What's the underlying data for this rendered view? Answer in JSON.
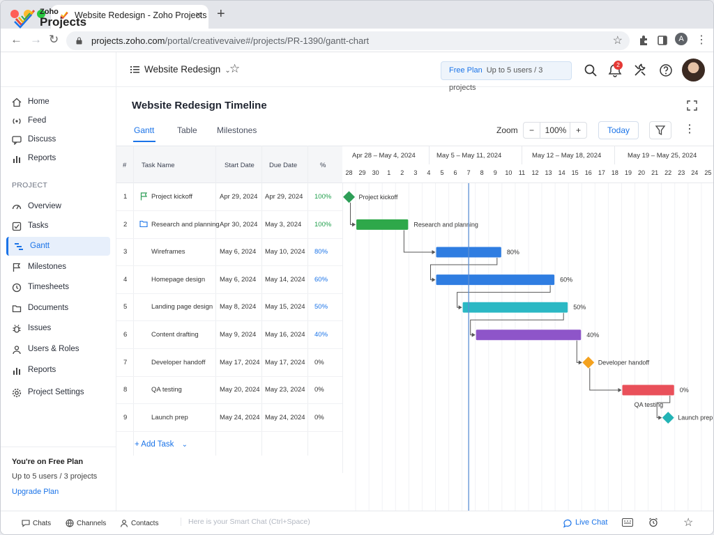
{
  "browser": {
    "tab_title": "Website Redesign - Zoho Projects",
    "url_host": "projects.zoho.com",
    "url_path": "/portal/creativevaive#/projects/PR-1390/gantt-chart",
    "account_initial": "A"
  },
  "brand": {
    "line1": "Zoho",
    "line2": "Projects"
  },
  "header": {
    "project_name": "Website Redesign",
    "plan_label": "Free Plan",
    "plan_text": "Up to 5 users / 3 projects",
    "notification_count": "2"
  },
  "sidebar": {
    "top_items": [
      {
        "label": "Home",
        "icon": "home-icon"
      },
      {
        "label": "Feed",
        "icon": "feed-icon"
      },
      {
        "label": "Discuss",
        "icon": "discuss-icon"
      },
      {
        "label": "Reports",
        "icon": "reports-icon"
      }
    ],
    "section_label": "PROJECT",
    "project_items": [
      {
        "label": "Overview"
      },
      {
        "label": "Tasks"
      },
      {
        "label": "Gantt",
        "active": true
      },
      {
        "label": "Milestones"
      },
      {
        "label": "Timesheets"
      },
      {
        "label": "Documents"
      },
      {
        "label": "Issues"
      },
      {
        "label": "Users & Roles"
      },
      {
        "label": "Reports"
      },
      {
        "label": "Project Settings"
      }
    ],
    "plan_title": "You're on Free Plan",
    "plan_desc": "Up to 5 users / 3 projects",
    "upgrade_label": "Upgrade Plan"
  },
  "main": {
    "title": "Website Redesign Timeline",
    "tabs": [
      "Gantt",
      "Table",
      "Milestones"
    ],
    "active_tab": "Gantt",
    "zoom_label": "Zoom",
    "zoom_value": "100%",
    "zoom_minus": "−",
    "zoom_plus": "+",
    "today_label": "Today",
    "add_task_label": "+ Add Task"
  },
  "grid": {
    "columns": [
      "#",
      "Task Name",
      "Start Date",
      "Due Date",
      "%"
    ],
    "rows": [
      {
        "num": "1",
        "name": "Project kickoff",
        "start": "Apr 29, 2024",
        "due": "Apr 29, 2024",
        "pct": "100%",
        "icon": "flag"
      },
      {
        "num": "2",
        "name": "Research and planning",
        "start": "Apr 30, 2024",
        "due": "May 3, 2024",
        "pct": "100%",
        "icon": "folder"
      },
      {
        "num": "3",
        "name": "Wireframes",
        "start": "May 6, 2024",
        "due": "May 10, 2024",
        "pct": "80%"
      },
      {
        "num": "4",
        "name": "Homepage design",
        "start": "May 6, 2024",
        "due": "May 14, 2024",
        "pct": "60%"
      },
      {
        "num": "5",
        "name": "Landing page design",
        "start": "May 8, 2024",
        "due": "May 15, 2024",
        "pct": "50%"
      },
      {
        "num": "6",
        "name": "Content drafting",
        "start": "May 9, 2024",
        "due": "May 16, 2024",
        "pct": "40%"
      },
      {
        "num": "7",
        "name": "Developer handoff",
        "start": "May 17, 2024",
        "due": "May 17, 2024",
        "pct": "0%"
      },
      {
        "num": "8",
        "name": "QA testing",
        "start": "May 20, 2024",
        "due": "May 23, 2024",
        "pct": "0%"
      },
      {
        "num": "9",
        "name": "Launch prep",
        "start": "May 24, 2024",
        "due": "May 24, 2024",
        "pct": "0%"
      }
    ]
  },
  "timeline": {
    "weeks": [
      "Apr 28 – May 4, 2024",
      "May 5 – May 11, 2024",
      "May 12 – May 18, 2024",
      "May 19 – May 25, 2024"
    ],
    "days": [
      "28",
      "29",
      "30",
      "1",
      "2",
      "3",
      "4",
      "5",
      "6",
      "7",
      "8",
      "9",
      "10",
      "11",
      "12",
      "13",
      "14",
      "15",
      "16",
      "17",
      "18",
      "19",
      "20",
      "21",
      "22",
      "23",
      "24",
      "25"
    ],
    "today_day_index": 9,
    "items": [
      {
        "row": 1,
        "type": "milestone",
        "start": 0,
        "end": 0,
        "label": "Project kickoff",
        "color": "#2e9e57"
      },
      {
        "row": 2,
        "type": "bar",
        "start": 1,
        "end": 4,
        "label": "Research and planning",
        "color": "#2ea84a"
      },
      {
        "row": 3,
        "type": "bar",
        "start": 7,
        "end": 11,
        "label": "80%",
        "color": "#2f7de1"
      },
      {
        "row": 4,
        "type": "bar",
        "start": 7,
        "end": 15,
        "label": "60%",
        "color": "#2f7de1"
      },
      {
        "row": 5,
        "type": "bar",
        "start": 9,
        "end": 16,
        "label": "50%",
        "color": "#2bb8c4"
      },
      {
        "row": 6,
        "type": "bar",
        "start": 10,
        "end": 17,
        "label": "40%",
        "color": "#8e55c9"
      },
      {
        "row": 7,
        "type": "milestone",
        "start": 18,
        "end": 18,
        "label": "Developer handoff",
        "color": "#f4a21f"
      },
      {
        "row": 8,
        "type": "bar",
        "start": 21,
        "end": 24,
        "label": "0%",
        "sublabel": "QA testing",
        "color": "#e9505a"
      },
      {
        "row": 9,
        "type": "milestone",
        "start": 24,
        "end": 24,
        "label": "Launch prep",
        "color": "#22b3b5"
      }
    ]
  },
  "bottom": {
    "chats": "Chats",
    "channels": "Channels",
    "contacts": "Contacts",
    "chat_placeholder": "Here is your Smart Chat (Ctrl+Space)",
    "live_chat": "Live Chat"
  }
}
